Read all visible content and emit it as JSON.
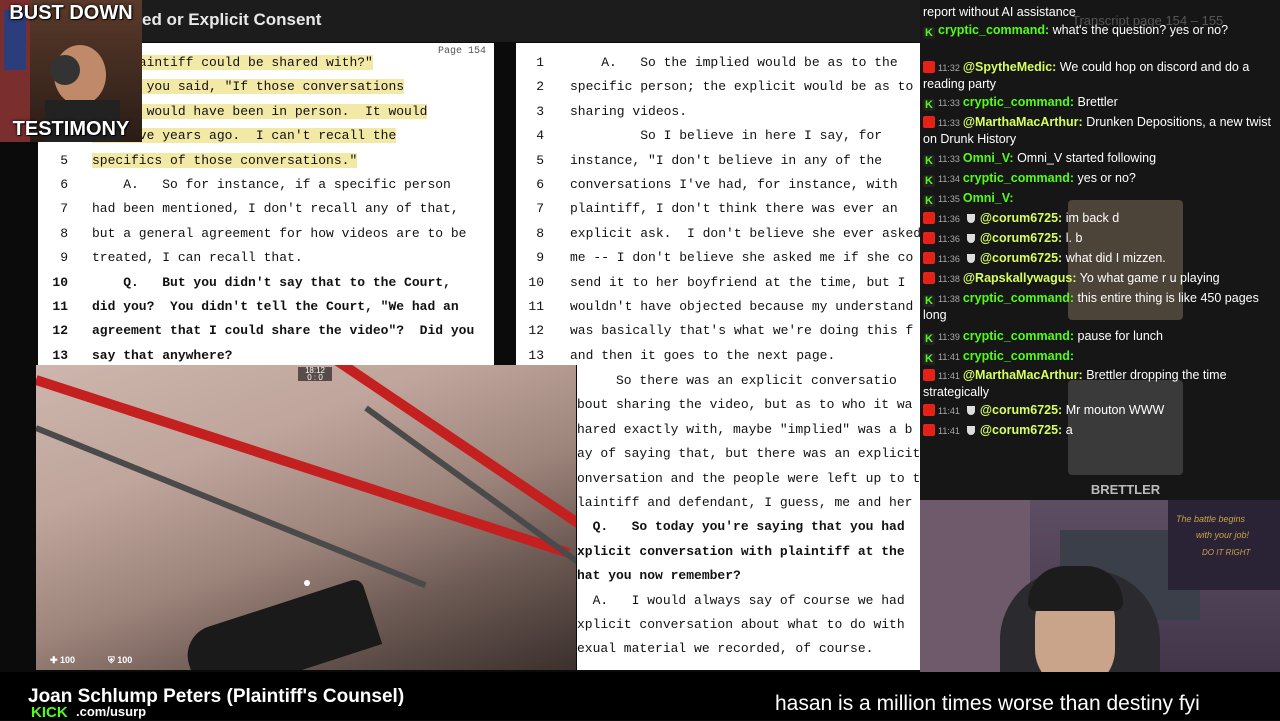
{
  "header": {
    "title": "ed or Explicit Consent"
  },
  "webcam": {
    "top_label": "BUST DOWN",
    "bottom_label": "TESTIMONY"
  },
  "left_page": {
    "page_label": "Page 154",
    "lines": [
      {
        "num": "",
        "text": "ith plaintiff could be shared with?\"",
        "hl": true,
        "bold": false
      },
      {
        "num": "",
        "text": "   And you said, \"If those conversations",
        "hl": true,
        "bold": false
      },
      {
        "num": "",
        "text": "ed, it would have been in person.  It would",
        "hl": true,
        "bold": false
      },
      {
        "num": "",
        "text": "een five years ago.  I can't recall the",
        "hl": true,
        "bold": false
      },
      {
        "num": "5",
        "text": "specifics of those conversations.\"",
        "hl": true,
        "bold": false
      },
      {
        "num": "6",
        "text": "    A.   So for instance, if a specific person",
        "hl": false,
        "bold": false
      },
      {
        "num": "7",
        "text": "had been mentioned, I don't recall any of that,",
        "hl": false,
        "bold": false
      },
      {
        "num": "8",
        "text": "but a general agreement for how videos are to be",
        "hl": false,
        "bold": false
      },
      {
        "num": "9",
        "text": "treated, I can recall that.",
        "hl": false,
        "bold": false
      },
      {
        "num": "10",
        "text": "    Q.   But you didn't say that to the Court,",
        "hl": false,
        "bold": true
      },
      {
        "num": "11",
        "text": "did you?  You didn't tell the Court, \"We had an",
        "hl": false,
        "bold": true
      },
      {
        "num": "12",
        "text": "agreement that I could share the video\"?  Did you",
        "hl": false,
        "bold": true
      },
      {
        "num": "13",
        "text": "say that anywhere?",
        "hl": false,
        "bold": true
      }
    ]
  },
  "right_page": {
    "lines": [
      {
        "num": "1",
        "text": "    A.   So the implied would be as to the",
        "bold": false
      },
      {
        "num": "2",
        "text": "specific person; the explicit would be as to",
        "bold": false
      },
      {
        "num": "3",
        "text": "sharing videos.",
        "bold": false
      },
      {
        "num": "4",
        "text": "         So I believe in here I say, for",
        "bold": false
      },
      {
        "num": "5",
        "text": "instance, \"I don't believe in any of the",
        "bold": false
      },
      {
        "num": "6",
        "text": "conversations I've had, for instance, with",
        "bold": false
      },
      {
        "num": "7",
        "text": "plaintiff, I don't think there was ever an",
        "bold": false
      },
      {
        "num": "8",
        "text": "explicit ask.  I don't believe she ever asked",
        "bold": false
      },
      {
        "num": "9",
        "text": "me -- I don't believe she asked me if she co",
        "bold": false
      },
      {
        "num": "10",
        "text": "send it to her boyfriend at the time, but I",
        "bold": false
      },
      {
        "num": "11",
        "text": "wouldn't have objected because my understand",
        "bold": false
      },
      {
        "num": "12",
        "text": "was basically that's what we're doing this f",
        "bold": false
      },
      {
        "num": "13",
        "text": "and then it goes to the next page.",
        "bold": false
      }
    ],
    "lower_lines": [
      {
        "text": "     So there was an explicit conversatio",
        "bold": false
      },
      {
        "text": "bout sharing the video, but as to who it wa",
        "bold": false
      },
      {
        "text": "hared exactly with, maybe \"implied\" was a b",
        "bold": false
      },
      {
        "text": "ay of saying that, but there was an explicit",
        "bold": false
      },
      {
        "text": "onversation and the people were left up to the",
        "bold": false
      },
      {
        "text": "laintiff and defendant, I guess, me and her",
        "bold": false
      },
      {
        "text": "  Q.   So today you're saying that you had",
        "bold": true
      },
      {
        "text": "xplicit conversation with plaintiff at the",
        "bold": true
      },
      {
        "text": "hat you now remember?",
        "bold": true
      },
      {
        "text": "  A.   I would always say of course we had",
        "bold": false
      },
      {
        "text": "xplicit conversation about what to do with",
        "bold": false
      },
      {
        "text": "exual material we recorded, of course.",
        "bold": false
      }
    ]
  },
  "game": {
    "timer": "18:12",
    "score": "0 : 0",
    "health": "100",
    "armor": "100"
  },
  "chat": {
    "overlay_text": "Transcript page 154 – 155",
    "messages": [
      {
        "platform": "",
        "time": "",
        "user": "",
        "text": "report without AI assistance",
        "mod": false
      },
      {
        "platform": "kick",
        "time": "",
        "user": "cryptic_command:",
        "text": "what's the question? yes or no?",
        "mod": false
      },
      {
        "platform": "youtube",
        "time": "11:32",
        "user": "@SpytheMedic:",
        "text": "We could hop on discord and do a reading party",
        "mod": false
      },
      {
        "platform": "kick",
        "time": "11:33",
        "user": "cryptic_command:",
        "text": "Brettler",
        "mod": false
      },
      {
        "platform": "youtube",
        "time": "11:33",
        "user": "@MarthaMacArthur:",
        "text": "Drunken Depositions, a new twist on Drunk History",
        "mod": false
      },
      {
        "platform": "kick",
        "time": "11:33",
        "user": "Omni_V:",
        "text": "Omni_V started following",
        "mod": false
      },
      {
        "platform": "kick",
        "time": "11:34",
        "user": "cryptic_command:",
        "text": "yes or no?",
        "mod": false
      },
      {
        "platform": "kick",
        "time": "11:35",
        "user": "Omni_V:",
        "text": "",
        "mod": false
      },
      {
        "platform": "youtube",
        "time": "11:36",
        "user": "@corum6725:",
        "text": "im back d",
        "mod": true
      },
      {
        "platform": "youtube",
        "time": "11:36",
        "user": "@corum6725:",
        "text": "l. b",
        "mod": true
      },
      {
        "platform": "youtube",
        "time": "11:36",
        "user": "@corum6725:",
        "text": "what did I mizzen.",
        "mod": true
      },
      {
        "platform": "youtube",
        "time": "11:38",
        "user": "@Rapskallywagus:",
        "text": "Yo what game r u playing",
        "mod": false
      },
      {
        "platform": "kick",
        "time": "11:38",
        "user": "cryptic_command:",
        "text": "this entire thing is like 450 pages long",
        "mod": false
      },
      {
        "platform": "kick",
        "time": "11:39",
        "user": "cryptic_command:",
        "text": "pause for lunch",
        "mod": false
      },
      {
        "platform": "kick",
        "time": "11:41",
        "user": "cryptic_command:",
        "text": "",
        "mod": false
      },
      {
        "platform": "youtube",
        "time": "11:41",
        "user": "@MarthaMacArthur:",
        "text": "Brettler dropping the time strategically",
        "mod": false
      },
      {
        "platform": "youtube",
        "time": "11:41",
        "user": "@corum6725:",
        "text": "Mr mouton WWW",
        "mod": true
      },
      {
        "platform": "youtube",
        "time": "11:41",
        "user": "@corum6725:",
        "text": "a",
        "mod": true
      }
    ],
    "witness_label": "BRETTLER",
    "poster_line1": "The battle begins",
    "poster_line2": "with your job!",
    "poster_line3": "DO IT RIGHT"
  },
  "lower_third": {
    "name": "Joan Schlump Peters (Plaintiff's Counsel)",
    "kick_logo": "KICK",
    "url": ".com/usurp"
  },
  "ticker": {
    "text": "hasan is a million times worse than destiny fyi"
  }
}
